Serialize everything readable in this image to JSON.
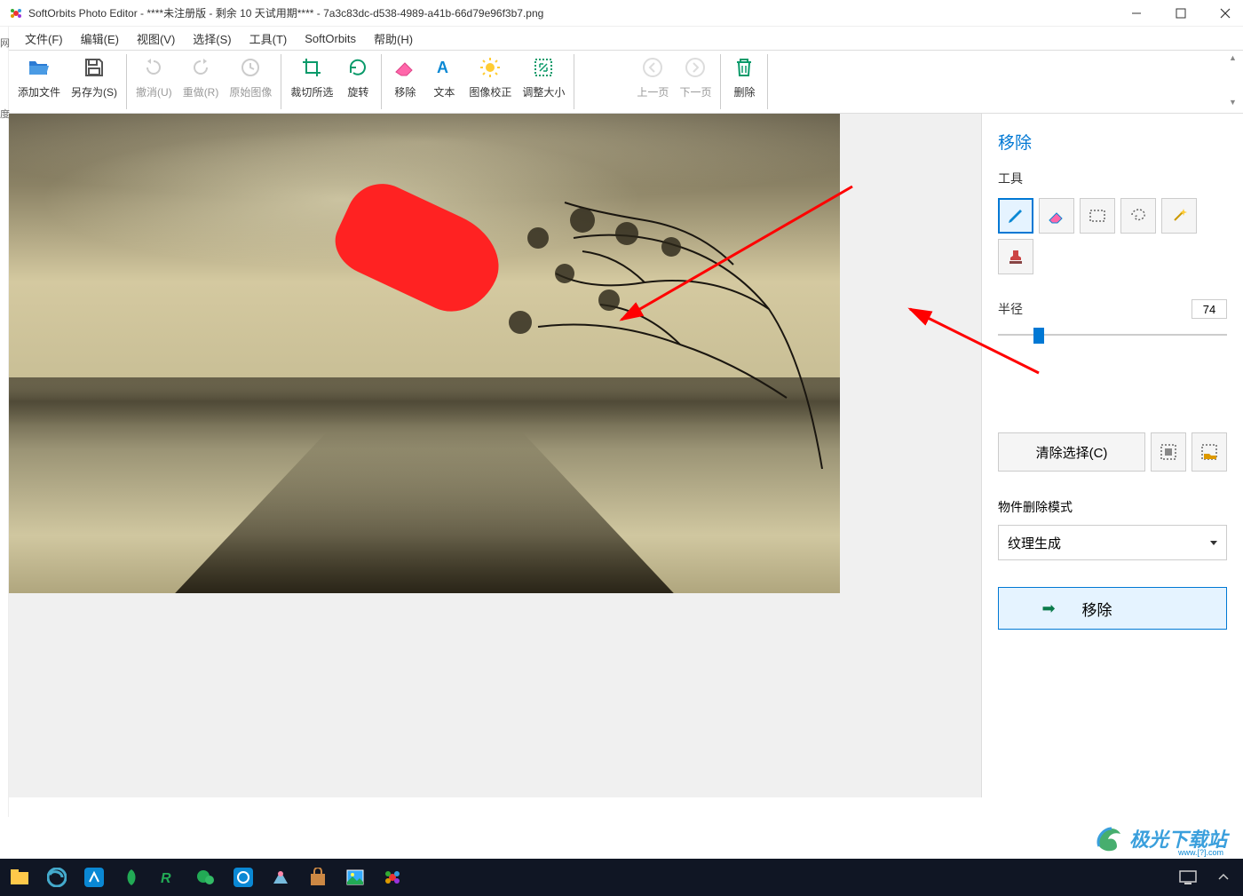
{
  "titlebar": {
    "app_name": "SoftOrbits Photo Editor",
    "title_full": "SoftOrbits Photo Editor - ****未注册版 - 剩余 10 天试用期**** - 7a3c83dc-d538-4989-a41b-66d79e96f3b7.png"
  },
  "menubar": {
    "file": "文件(F)",
    "edit": "编辑(E)",
    "view": "视图(V)",
    "select": "选择(S)",
    "tools": "工具(T)",
    "softorbits": "SoftOrbits",
    "help": "帮助(H)"
  },
  "toolbar": {
    "add_file": "添加文件",
    "save_as": "另存为(S)",
    "undo": "撤消(U)",
    "redo": "重做(R)",
    "original": "原始图像",
    "crop": "裁切所选",
    "rotate": "旋转",
    "remove": "移除",
    "text": "文本",
    "correction": "图像校正",
    "resize": "调整大小",
    "prev": "上一页",
    "next": "下一页",
    "delete": "删除"
  },
  "sidepanel": {
    "title": "移除",
    "tools_label": "工具",
    "radius_label": "半径",
    "radius_value": "74",
    "clear_selection": "清除选择(C)",
    "mode_label": "物件删除模式",
    "mode_value": "纹理生成",
    "remove_button": "移除",
    "tool_names": [
      "pencil",
      "eraser",
      "rect-select",
      "lasso",
      "magic-wand",
      "stamp"
    ]
  },
  "leftedge": {
    "a": "网",
    "b": "度"
  },
  "watermark": {
    "text": "极光下载站",
    "sub": "www.[?].com"
  }
}
